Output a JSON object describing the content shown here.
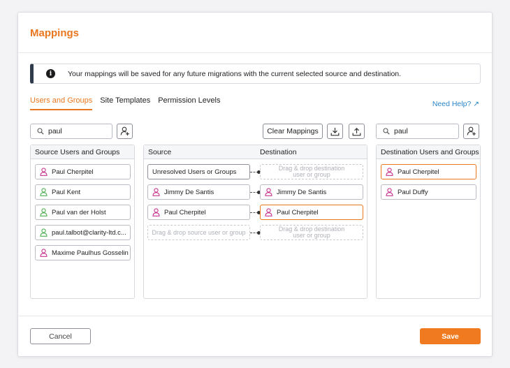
{
  "dialog": {
    "title": "Mappings"
  },
  "info": {
    "text": "Your mappings will be saved for any future migrations with the current selected source and destination."
  },
  "tabs": [
    {
      "label": "Users and Groups",
      "active": true
    },
    {
      "label": "Site Templates",
      "active": false
    },
    {
      "label": "Permission Levels",
      "active": false
    }
  ],
  "help": {
    "label": "Need Help? ↗"
  },
  "source_search": {
    "value": "paul"
  },
  "dest_search": {
    "value": "paul"
  },
  "toolbar": {
    "clear_label": "Clear Mappings"
  },
  "source_panel": {
    "header": "Source Users and Groups",
    "items": [
      {
        "label": "Paul Cherpitel",
        "type": "user",
        "color": "#c8338f"
      },
      {
        "label": "Paul Kent",
        "type": "user",
        "color": "#4caf50"
      },
      {
        "label": "Paul van der Holst",
        "type": "user",
        "color": "#4caf50"
      },
      {
        "label": "paul.talbot@clarity-ltd.c...",
        "type": "user",
        "color": "#4caf50"
      },
      {
        "label": "Maxime Paulhus Gosselin",
        "type": "user",
        "color": "#c8338f"
      }
    ]
  },
  "mapping_panel": {
    "source_header": "Source",
    "dest_header": "Destination",
    "rows": [
      {
        "source": "Unresolved Users or Groups",
        "destination": "Drag & drop destination user or group"
      },
      {
        "source": "Jimmy De Santis",
        "destination": "Jimmy De Santis"
      },
      {
        "source": "Paul Cherpitel",
        "destination": "Paul Cherpitel"
      },
      {
        "source": "Drag & drop source user or group",
        "destination": "Drag & drop destination user or group"
      }
    ]
  },
  "dest_panel": {
    "header": "Destination Users and Groups",
    "items": [
      {
        "label": "Paul Cherpitel",
        "type": "user",
        "color": "#c8338f"
      },
      {
        "label": "Paul Duffy",
        "type": "user",
        "color": "#c8338f"
      }
    ]
  },
  "footer": {
    "cancel_label": "Cancel",
    "save_label": "Save"
  },
  "colors": {
    "accent": "#e8771f",
    "link": "#2a86c9",
    "user_pink": "#c8338f",
    "user_green": "#4caf50"
  }
}
